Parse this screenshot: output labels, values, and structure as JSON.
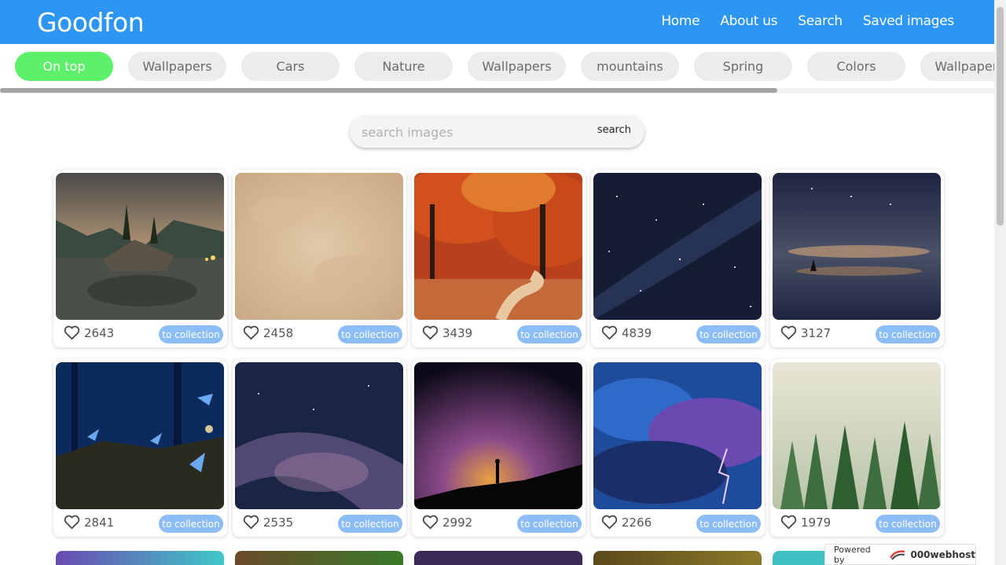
{
  "header": {
    "logo": "Goodfon",
    "nav": [
      "Home",
      "About us",
      "Search",
      "Saved images"
    ]
  },
  "categories": [
    "On top",
    "Wallpapers",
    "Cars",
    "Nature",
    "Wallpapers",
    "mountains",
    "Spring",
    "Colors",
    "Wallpapers"
  ],
  "search": {
    "placeholder": "search images",
    "button": "search"
  },
  "cards": [
    {
      "likes": "2643",
      "button": "to collection",
      "subject": "lake-island-trees"
    },
    {
      "likes": "2458",
      "button": "to collection",
      "subject": "parchment-texture"
    },
    {
      "likes": "3439",
      "button": "to collection",
      "subject": "autumn-forest-path"
    },
    {
      "likes": "4839",
      "button": "to collection",
      "subject": "starry-sky"
    },
    {
      "likes": "3127",
      "button": "to collection",
      "subject": "night-boat-reflection"
    },
    {
      "likes": "2841",
      "button": "to collection",
      "subject": "blue-butterflies"
    },
    {
      "likes": "2535",
      "button": "to collection",
      "subject": "milky-way"
    },
    {
      "likes": "2992",
      "button": "to collection",
      "subject": "galaxy-silhouette"
    },
    {
      "likes": "2266",
      "button": "to collection",
      "subject": "storm-lightning"
    },
    {
      "likes": "1979",
      "button": "to collection",
      "subject": "misty-pine-forest"
    }
  ],
  "powered": {
    "prefix": "Powered by",
    "brand": "000webhost"
  },
  "colors": {
    "header": "#2d96f3",
    "active_chip": "#5ef06a",
    "collection_button": "#8cbdf6"
  }
}
